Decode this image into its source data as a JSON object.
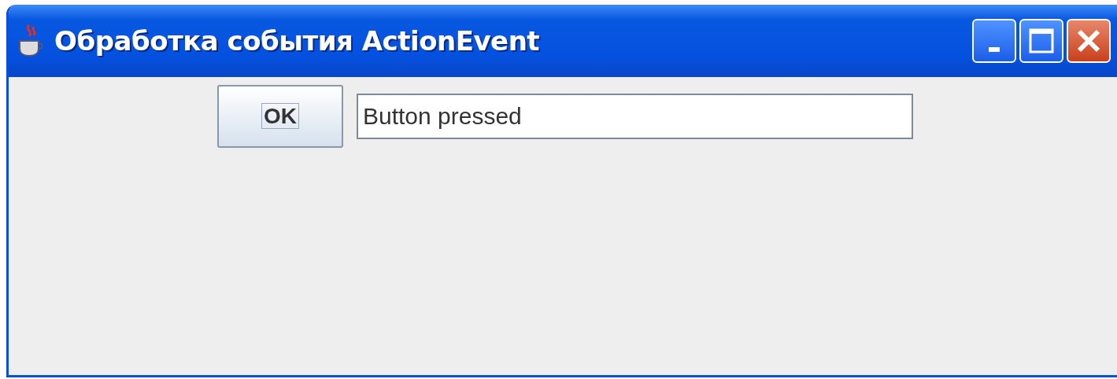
{
  "window": {
    "title": "Обработка события ActionEvent"
  },
  "button": {
    "label": "OK",
    "focused": true
  },
  "text_field": {
    "value": "Button pressed"
  }
}
